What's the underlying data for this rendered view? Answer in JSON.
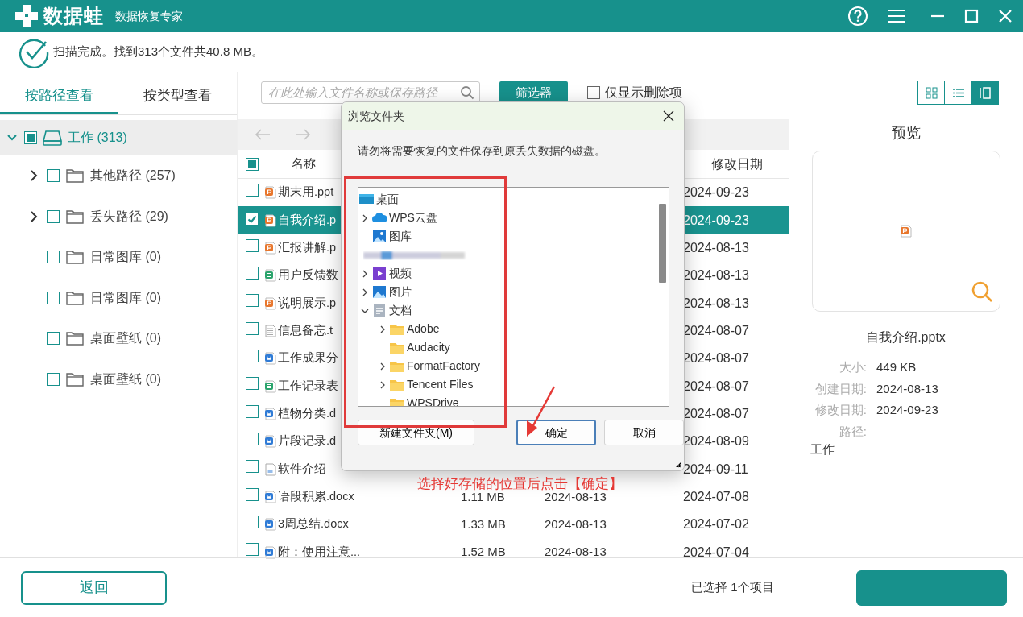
{
  "app": {
    "name": "数据蛙",
    "subtitle": "数据恢复专家"
  },
  "scan_status": "扫描完成。找到313个文件共40.8 MB。",
  "view_tabs": [
    {
      "label": "按路径查看",
      "selected": true
    },
    {
      "label": "按类型查看",
      "selected": false
    }
  ],
  "tree": {
    "label": "工作 (313)",
    "checked": false,
    "partial": true,
    "expanded": true,
    "children": [
      {
        "label": "其他路径 (257)",
        "checked": false,
        "expanded": false
      },
      {
        "label": "丢失路径 (29)",
        "checked": false,
        "expanded": false
      },
      {
        "label": "日常图库 (0)",
        "checked": false
      },
      {
        "label": "日常图库 (0)",
        "checked": false
      },
      {
        "label": "桌面壁纸 (0)",
        "checked": false
      },
      {
        "label": "桌面壁纸 (0)",
        "checked": false
      }
    ]
  },
  "search": {
    "placeholder": "在此处输入文件名称或保存路径"
  },
  "filter_button": "筛选器",
  "deleted_only": {
    "label": "仅显示删除项",
    "checked": false
  },
  "view_modes": [
    {
      "kind": "grid",
      "selected": false
    },
    {
      "kind": "list",
      "selected": false
    },
    {
      "kind": "columns",
      "selected": true
    }
  ],
  "nav": {
    "back_disabled": true,
    "forward_disabled": true
  },
  "table": {
    "header_checked": false,
    "header_partial": true,
    "columns": [
      {
        "label": "名称"
      },
      {
        "label": "修改日期"
      }
    ],
    "rows": [
      {
        "kind": "ppt",
        "name": "期末用.ppt",
        "modified": "2024-09-23",
        "checked": false,
        "selected": false
      },
      {
        "kind": "ppt",
        "name": "自我介绍.p",
        "modified": "2024-09-23",
        "checked": true,
        "selected": true
      },
      {
        "kind": "ppt",
        "name": "汇报讲解.p",
        "modified": "2024-08-13",
        "checked": false,
        "selected": false
      },
      {
        "kind": "sheet",
        "name": "用户反馈数",
        "modified": "2024-08-13",
        "checked": false,
        "selected": false
      },
      {
        "kind": "ppt",
        "name": "说明展示.p",
        "modified": "2024-08-13",
        "checked": false,
        "selected": false
      },
      {
        "kind": "text",
        "name": "信息备忘.t",
        "modified": "2024-08-07",
        "checked": false,
        "selected": false
      },
      {
        "kind": "word",
        "name": "工作成果分",
        "modified": "2024-08-07",
        "checked": false,
        "selected": false
      },
      {
        "kind": "sheet",
        "name": "工作记录表",
        "modified": "2024-08-07",
        "checked": false,
        "selected": false
      },
      {
        "kind": "word",
        "name": "植物分类.d",
        "modified": "2024-08-07",
        "checked": false,
        "selected": false
      },
      {
        "kind": "word",
        "name": "片段记录.d",
        "modified": "2024-08-09",
        "checked": false,
        "selected": false
      },
      {
        "kind": "doc",
        "name": "软件介绍",
        "modified": "2024-09-11",
        "checked": false,
        "selected": false
      },
      {
        "kind": "word",
        "name": "语段积累.docx",
        "size": "1.11 MB",
        "created": "2024-08-13",
        "modified": "2024-07-08",
        "checked": false,
        "selected": false
      },
      {
        "kind": "word",
        "name": "3周总结.docx",
        "size": "1.33 MB",
        "created": "2024-08-13",
        "modified": "2024-07-02",
        "checked": false,
        "selected": false
      },
      {
        "kind": "word",
        "name": "附：使用注意...",
        "size": "1.52 MB",
        "created": "2024-08-13",
        "modified": "2024-07-04",
        "checked": false,
        "selected": false
      }
    ]
  },
  "dialog": {
    "title": "浏览文件夹",
    "message": "请勿将需要恢复的文件保存到原丢失数据的磁盘。",
    "folders": [
      {
        "kind": "desktop",
        "label": "桌面",
        "children": [
          {
            "kind": "cloud",
            "label": "WPS云盘",
            "expanded": false
          },
          {
            "kind": "gallery",
            "label": "图库"
          },
          {
            "kind": "blurred"
          },
          {
            "kind": "video",
            "label": "视频",
            "expanded": false
          },
          {
            "kind": "pictures",
            "label": "图片",
            "expanded": false
          },
          {
            "kind": "documents",
            "label": "文档",
            "expanded": true,
            "children": [
              {
                "kind": "folder",
                "label": "Adobe",
                "expanded": false
              },
              {
                "kind": "folder",
                "label": "Audacity"
              },
              {
                "kind": "folder",
                "label": "FormatFactory",
                "expanded": false
              },
              {
                "kind": "folder",
                "label": "Tencent Files",
                "expanded": false
              },
              {
                "kind": "folder",
                "label": "WPSDrive"
              }
            ]
          }
        ]
      }
    ],
    "buttons": [
      {
        "label": "新建文件夹(M)",
        "focused": false
      },
      {
        "label": "确定",
        "focused": true
      },
      {
        "label": "取消",
        "focused": false
      }
    ]
  },
  "annotation": {
    "text": "选择好存储的位置后点击【确定】"
  },
  "preview": {
    "title": "预览",
    "kind": "ppt",
    "file_name": "自我介绍.pptx",
    "details": [
      {
        "label": "大小:",
        "value": "449 KB"
      },
      {
        "label": "创建日期:",
        "value": "2024-08-13"
      },
      {
        "label": "修改日期:",
        "value": "2024-09-23"
      },
      {
        "label": "路径:"
      }
    ],
    "path": "工作"
  },
  "footer": {
    "back_button": "返回",
    "selection": "已选择 1个项目"
  }
}
